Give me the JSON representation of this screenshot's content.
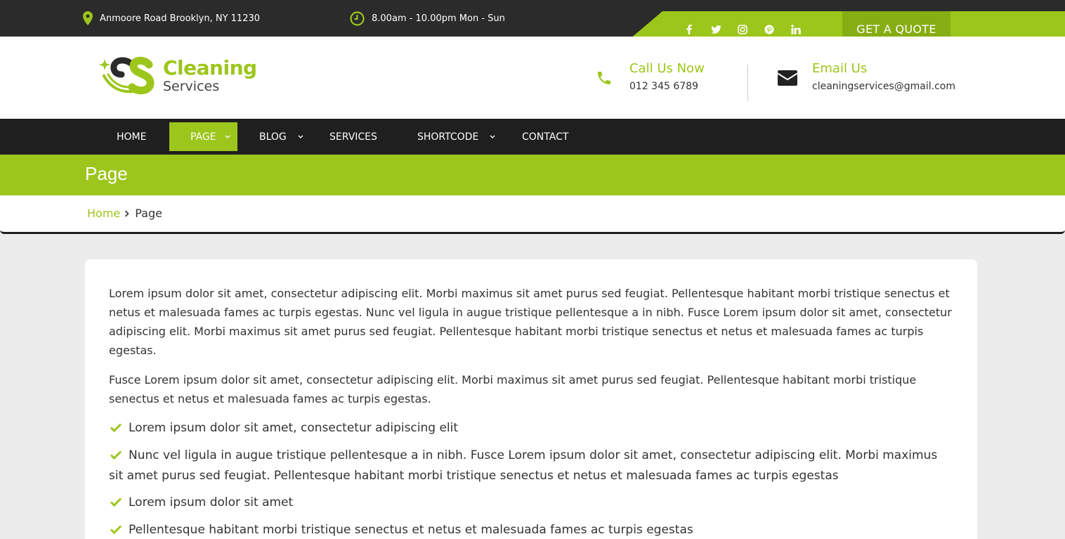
{
  "topbar": {
    "address": "Anmoore Road Brooklyn, NY 11230",
    "hours": "8.00am - 10.00pm Mon - Sun",
    "social_icons": [
      "facebook-icon",
      "twitter-icon",
      "instagram-icon",
      "pinterest-icon",
      "linkedin-icon"
    ],
    "quote_label": "GET A QUOTE"
  },
  "header": {
    "logo_title": "Cleaning",
    "logo_sub": "Services",
    "call_title": "Call Us Now",
    "call_value": "012 345 6789",
    "email_title": "Email Us",
    "email_value": "cleaningservices@gmail.com"
  },
  "nav": {
    "items": [
      {
        "label": "HOME"
      },
      {
        "label": "PAGE"
      },
      {
        "label": "BLOG"
      },
      {
        "label": "SERVICES"
      },
      {
        "label": "SHORTCODE"
      },
      {
        "label": "CONTACT"
      }
    ]
  },
  "page_title": "Page",
  "breadcrumb": {
    "home": "Home",
    "current": "Page"
  },
  "content": {
    "p1": "Lorem ipsum dolor sit amet, consectetur adipiscing elit. Morbi maximus sit amet purus sed feugiat. Pellentesque habitant morbi tristique senectus et netus et malesuada fames ac turpis egestas. Nunc vel ligula in augue tristique pellentesque a in nibh. Fusce Lorem ipsum dolor sit amet, consectetur adipiscing elit. Morbi maximus sit amet purus sed feugiat. Pellentesque habitant morbi tristique senectus et netus et malesuada fames ac turpis egestas.",
    "p2": "Fusce Lorem ipsum dolor sit amet, consectetur adipiscing elit. Morbi maximus sit amet purus sed feugiat. Pellentesque habitant morbi tristique senectus et netus et malesuada fames ac turpis egestas.",
    "list": [
      "Lorem ipsum dolor sit amet, consectetur adipiscing elit",
      "Nunc vel ligula in augue tristique pellentesque a in nibh. Fusce Lorem ipsum dolor sit amet, consectetur adipiscing elit. Morbi maximus sit amet purus sed feugiat. Pellentesque habitant morbi tristique senectus et netus et malesuada fames ac turpis egestas",
      "Lorem ipsum dolor sit amet",
      "Pellentesque habitant morbi tristique senectus et netus et malesuada fames ac turpis egestas"
    ]
  },
  "colors": {
    "accent": "#9cc61b",
    "accent_dark": "#86ad12",
    "dark": "#1f1f1f",
    "topbar": "#2b2b2b",
    "background": "#ececec"
  }
}
